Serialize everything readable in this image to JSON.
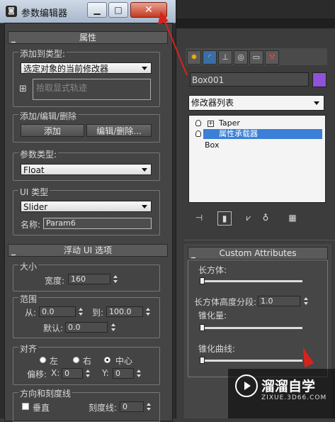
{
  "window": {
    "title": "参数编辑器",
    "min": "▁",
    "max": "□",
    "close": "✕"
  },
  "attributes": {
    "header": "属性",
    "add_to_type_label": "添加到类型:",
    "add_to_type_value": "选定对象的当前修改器",
    "pick_track": "拾取显式轨迹",
    "add_edit_delete_label": "添加/编辑/删除",
    "add_button": "添加",
    "edit_delete_button": "编辑/删除...",
    "param_type_label": "参数类型:",
    "param_type_value": "Float",
    "ui_type_label": "UI 类型",
    "ui_type_value": "Slider",
    "name_label": "名称:",
    "name_value": "Param6"
  },
  "float_ui": {
    "header": "浮动 UI 选项",
    "size_label": "大小",
    "width_label": "宽度:",
    "width_value": "160",
    "range_label": "范围",
    "from_label": "从:",
    "from_value": "0.0",
    "to_label": "到:",
    "to_value": "100.0",
    "default_label": "默认:",
    "default_value": "0.0",
    "align_label": "对齐",
    "align_left": "左",
    "align_right": "右",
    "align_center": "中心",
    "offset_label": "偏移:",
    "x_label": "X:",
    "x_value": "0",
    "y_label": "Y:",
    "y_value": "0",
    "orientation_label": "方向和刻度线",
    "vertical_label": "垂直",
    "ticks_label": "刻度线:",
    "ticks_value": "0"
  },
  "command_panel": {
    "object_name": "Box001",
    "object_color": "#8e53d8",
    "modifier_list_label": "修改器列表",
    "stack": [
      "Taper",
      "属性承载器",
      "Box"
    ],
    "selected_stack_index": 1
  },
  "custom_attributes": {
    "header": "Custom Attributes",
    "box_label": "长方体:",
    "box_height_segs_label": "长方体高度分段:",
    "box_height_segs_value": "1.0",
    "taper_amount_label": "锥化量:",
    "taper_curve_label": "锥化曲线:"
  },
  "watermark": {
    "title": "溜溜自学",
    "url": "ZIXUE.3D66.COM"
  },
  "colors": {
    "accent_blue": "#3b7fd6",
    "close_red": "#c33a22",
    "arrow_red": "#d8231c"
  }
}
